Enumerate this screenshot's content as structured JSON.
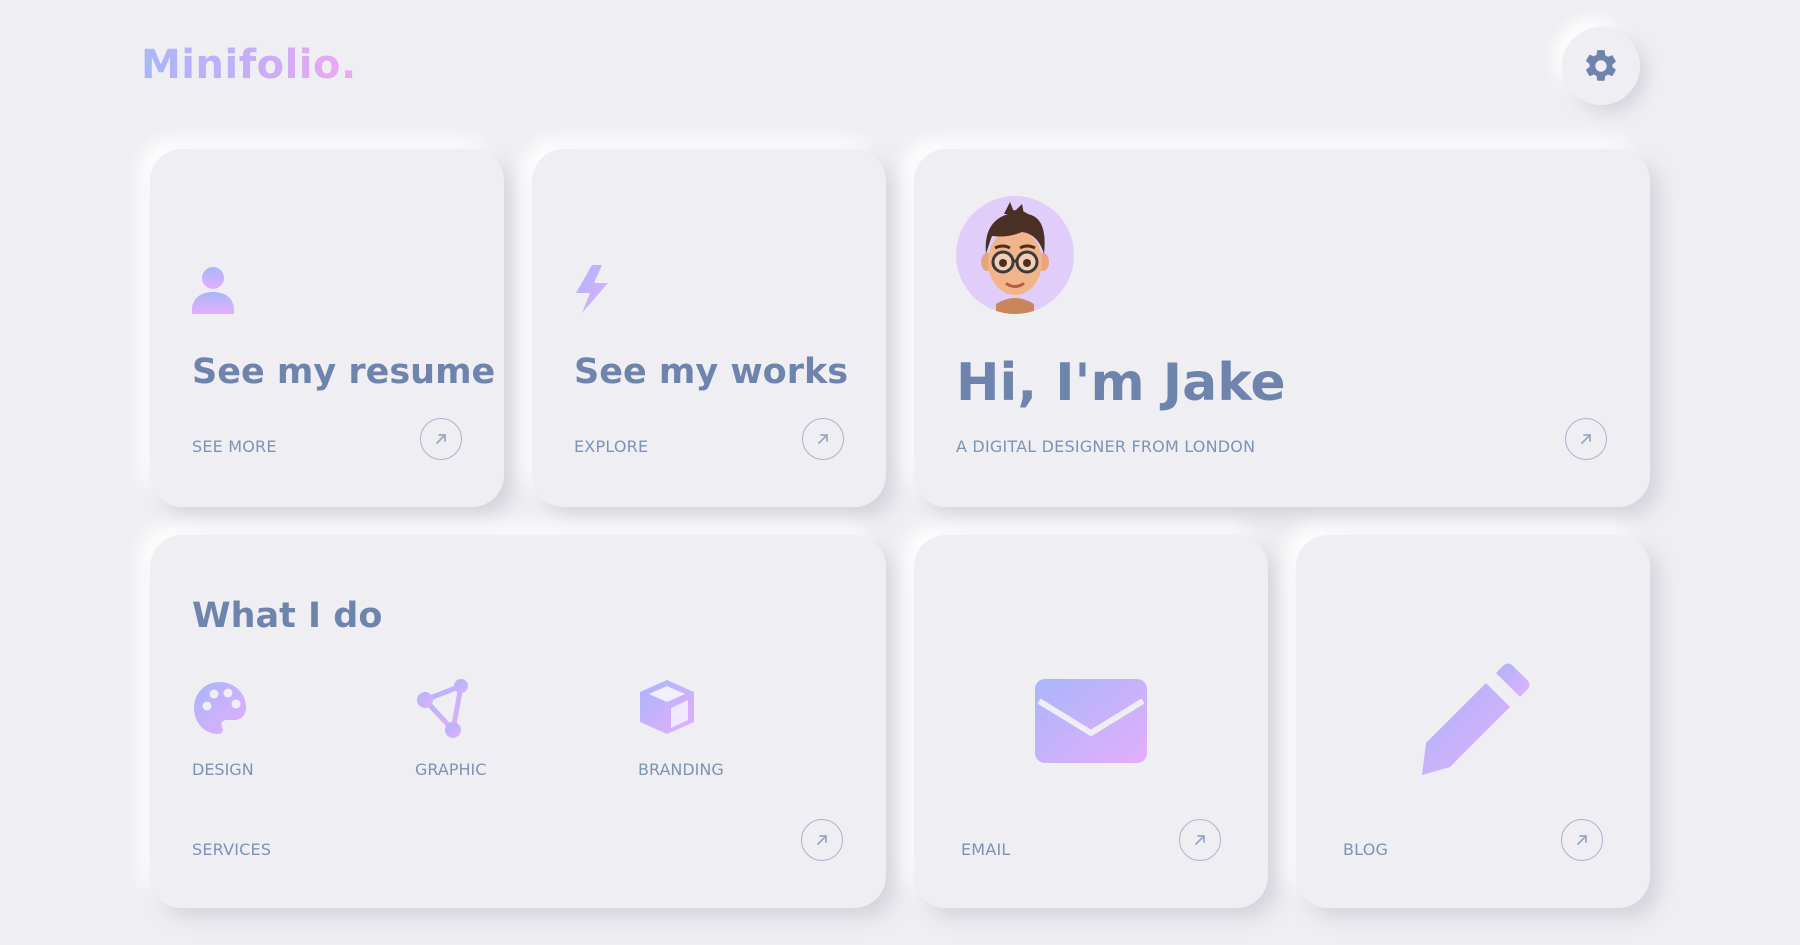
{
  "header": {
    "logo": "Minifolio.",
    "settings_icon": "gear-icon"
  },
  "resume_card": {
    "icon": "user-icon",
    "title": "See my resume",
    "subtitle": "SEE MORE",
    "arrow_icon": "arrow-up-right-icon"
  },
  "works_card": {
    "icon": "lightning-icon",
    "title": "See my works",
    "subtitle": "EXPLORE",
    "arrow_icon": "arrow-up-right-icon"
  },
  "intro_card": {
    "avatar": "memoji-avatar",
    "title": "Hi, I'm Jake",
    "subtitle": "A DIGITAL DESIGNER FROM LONDON",
    "arrow_icon": "arrow-up-right-icon"
  },
  "services_card": {
    "title": "What I do",
    "services": [
      {
        "label": "DESIGN",
        "icon": "palette-icon"
      },
      {
        "label": "GRAPHIC",
        "icon": "vector-nodes-icon"
      },
      {
        "label": "BRANDING",
        "icon": "box-icon"
      }
    ],
    "subtitle": "SERVICES",
    "arrow_icon": "arrow-up-right-icon"
  },
  "email_card": {
    "icon": "envelope-icon",
    "subtitle": "EMAIL",
    "arrow_icon": "arrow-up-right-icon"
  },
  "blog_card": {
    "icon": "pencil-icon",
    "subtitle": "BLOG",
    "arrow_icon": "arrow-up-right-icon"
  },
  "colors": {
    "background": "#efeff3",
    "title_text": "#6f84ad",
    "sub_text": "#7c93b5",
    "gradient_start": "#a9b6fb",
    "gradient_end": "#e4aefb"
  }
}
